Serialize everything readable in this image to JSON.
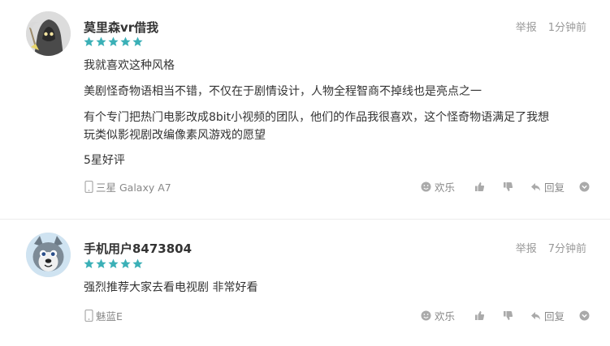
{
  "colors": {
    "star": "#3bb0b7",
    "meta": "#999999",
    "icon": "#aaaaaa"
  },
  "comments": [
    {
      "user": "莫里森vr借我",
      "rating": 5,
      "report": "举报",
      "time": "1分钟前",
      "lines": [
        "我就喜欢这种风格",
        "美剧怪奇物语相当不错，不仅在于剧情设计，人物全程智商不掉线也是亮点之一",
        "有个专门把热门电影改成8bit小视频的团队，他们的作品我很喜欢，这个怪奇物语满足了我想",
        "玩类似影视剧改编像素风游戏的愿望",
        "5星好评"
      ],
      "device": "三星 Galaxy A7",
      "actions": {
        "funny": "欢乐",
        "reply": "回复"
      },
      "avatar_icon": "grim-reaper-icon"
    },
    {
      "user": "手机用户8473804",
      "rating": 5,
      "report": "举报",
      "time": "7分钟前",
      "lines": [
        "强烈推荐大家去看电视剧 非常好看"
      ],
      "device": "魅蓝E",
      "actions": {
        "funny": "欢乐",
        "reply": "回复"
      },
      "avatar_icon": "husky-dog-icon"
    }
  ]
}
